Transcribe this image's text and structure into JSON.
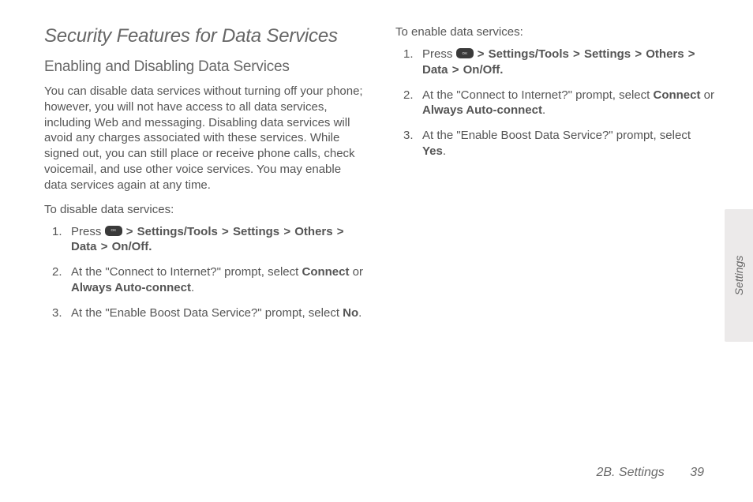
{
  "section_title": "Security Features for Data Services",
  "subhead": "Enabling and Disabling Data Services",
  "intro": "You can disable data services without turning off your phone; however, you will not have access to all data services, including Web and messaging. Disabling data services will avoid any charges associated with these services. While signed out, you can still place or receive phone calls, check voicemail, and use other voice services. You may enable data services again at any time.",
  "left": {
    "lead": "To disable data services:",
    "step1_pre": "Press ",
    "nav_path": {
      "a": "Settings/Tools",
      "b": "Settings",
      "c": "Others",
      "d": "Data",
      "e": "On/Off."
    },
    "step2_pre": "At the \"Connect to Internet?\" prompt, select ",
    "connect": "Connect",
    "or": " or ",
    "auto": "Always Auto-connect",
    "step3_pre": "At the \"Enable Boost Data Service?\" prompt, select ",
    "no": "No"
  },
  "right": {
    "lead": "To enable data services:",
    "step1_pre": "Press ",
    "nav_path": {
      "a": "Settings/Tools",
      "b": "Settings",
      "c": "Others",
      "d": "Data",
      "e": "On/Off."
    },
    "step2_pre": "At the \"Connect to Internet?\" prompt, select ",
    "connect": "Connect",
    "or": " or ",
    "auto": "Always Auto-connect",
    "step3_pre": "At the \"Enable Boost Data Service?\" prompt, select ",
    "yes": "Yes"
  },
  "side_tab": "Settings",
  "footer_section": "2B. Settings",
  "page_number": "39",
  "glyphs": {
    "gt": ">"
  }
}
